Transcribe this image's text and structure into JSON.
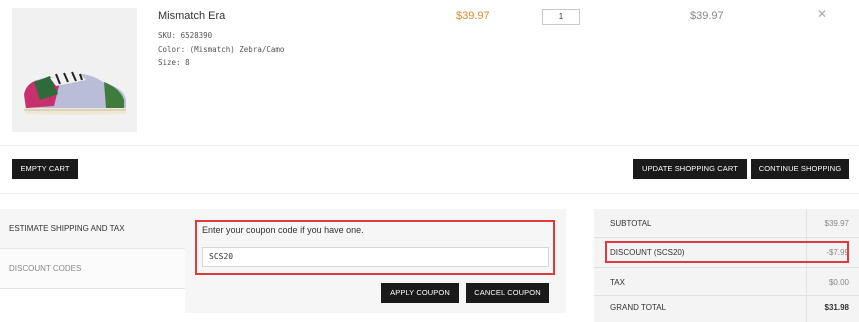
{
  "product": {
    "name": "Mismatch Era",
    "sku_label": "SKU:",
    "sku": "6528390",
    "color_label": "Color:",
    "color": "(Mismatch) Zebra/Camo",
    "size_label": "Size:",
    "size": "8",
    "price": "$39.97",
    "quantity": "1",
    "subtotal": "$39.97",
    "remove_icon": "close-icon"
  },
  "actions": {
    "empty_cart": "EMPTY CART",
    "update_cart": "UPDATE SHOPPING CART",
    "continue_shopping": "CONTINUE SHOPPING"
  },
  "tabs": {
    "shipping": "ESTIMATE SHIPPING AND TAX",
    "discount": "DISCOUNT CODES"
  },
  "coupon": {
    "prompt": "Enter your coupon code if you have one.",
    "value": "SCS20",
    "apply": "APPLY COUPON",
    "cancel": "CANCEL COUPON"
  },
  "totals": {
    "subtotal_label": "SUBTOTAL",
    "subtotal": "$39.97",
    "discount_label": "DISCOUNT (SCS20)",
    "discount": "-$7.99",
    "tax_label": "TAX",
    "tax": "$0.00",
    "grand_total_label": "GRAND TOTAL",
    "grand_total": "$31.98"
  },
  "colors": {
    "price": "#d98a2b",
    "button": "#1a1a1a",
    "highlight": "#e03a3a"
  }
}
